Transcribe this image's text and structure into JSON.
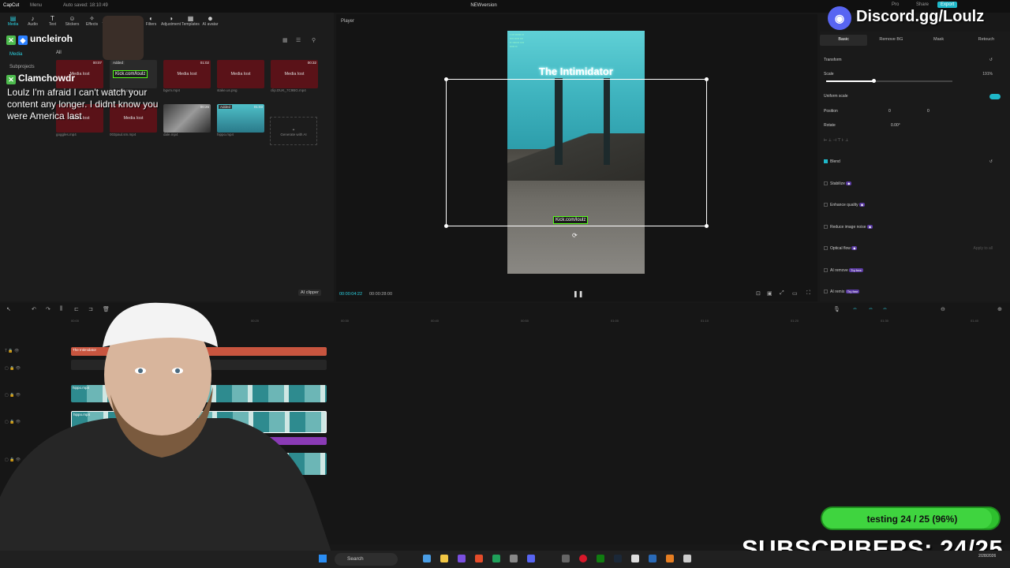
{
  "app": {
    "logo": "CapCut",
    "menu": "Menu",
    "autosave": "Auto saved: 18:10:49",
    "project_title": "NEWversion",
    "pro_label": "Pro",
    "share_label": "Share",
    "export_label": "Export"
  },
  "toolbar": {
    "items": [
      {
        "icon": "media-icon",
        "label": "Media"
      },
      {
        "icon": "audio-icon",
        "label": "Audio"
      },
      {
        "icon": "text-icon",
        "label": "Text"
      },
      {
        "icon": "stickers-icon",
        "label": "Stickers"
      },
      {
        "icon": "effects-icon",
        "label": "Effects"
      },
      {
        "icon": "transitions-icon",
        "label": "Transitions"
      },
      {
        "icon": "captions-icon",
        "label": "Captions"
      },
      {
        "icon": "filters-icon",
        "label": "Filters"
      },
      {
        "icon": "adjustment-icon",
        "label": "Adjustment"
      },
      {
        "icon": "templates-icon",
        "label": "Templates"
      },
      {
        "icon": "ai-avatar-icon",
        "label": "AI avatar"
      }
    ]
  },
  "media_panel": {
    "nav_media": "Media",
    "nav_subprojects": "Subprojects",
    "filter_all": "All",
    "thumbs_row1": [
      {
        "lost": "Media lost",
        "dur": "00:07",
        "name": ""
      },
      {
        "lost": "",
        "dur": "",
        "added": "Added",
        "name": "kick.Loulz.png",
        "tag": "Kick.com/loulz"
      },
      {
        "lost": "Media lost",
        "dur": "01:02",
        "name": "bgvm.mp4"
      },
      {
        "lost": "Media lost",
        "dur": "",
        "name": "stake.us.png"
      },
      {
        "lost": "Media lost",
        "dur": "00:32",
        "name": "clip.DUK_7C9BG.mp4"
      }
    ],
    "thumbs_row2": [
      {
        "lost": "Media lost",
        "name": "goggles.mp4"
      },
      {
        "lost": "Media lost",
        "name": "003paul.sm.mp4"
      },
      {
        "lost": "",
        "dur": "00:26",
        "name": "dale.mp4"
      },
      {
        "lost": "",
        "dur": "01:03",
        "added": "Added",
        "name": "hippo.mp4"
      }
    ],
    "generate_ai": "Generate with AI",
    "ai_clipper": "AI clipper"
  },
  "chat": {
    "user1": "uncleiroh",
    "user2": "Clamchowdr",
    "message": "Loulz I'm afraid I can't watch your content any longer. I didnt know you were America last"
  },
  "player": {
    "label": "Player",
    "video_title": "The Intimidator",
    "kick_tag": "Kick.com/loulz",
    "time_current": "00:00:04:22",
    "time_total": "00:00:28:00"
  },
  "right_panel": {
    "tabs": [
      "Basic",
      "Remove BG",
      "Mask",
      "Retouch"
    ],
    "transform": "Transform",
    "scale_label": "Scale",
    "scale_value": "191%",
    "uniform_scale": "Uniform scale",
    "position_label": "Position",
    "pos_x": "0",
    "pos_y": "0",
    "rotate_label": "Rotate",
    "rotate_value": "0.00°",
    "blend": "Blend",
    "stabilize": "Stabilize",
    "enhance_quality": "Enhance quality",
    "reduce_noise": "Reduce image noise",
    "optical_flow": "Optical flow",
    "ai_remove": "AI remove",
    "ai_remix": "AI remix",
    "try_free": "Try free",
    "apply_all": "Apply to all"
  },
  "timeline": {
    "ruler": [
      "00:00",
      "00:10",
      "00:20",
      "00:30",
      "00:40",
      "00:50",
      "01:00",
      "01:10",
      "01:20",
      "01:30",
      "01:40"
    ],
    "text_clip": "The Intimidator",
    "clip1": "hippo.mp4",
    "clip2": "hippo.mp4"
  },
  "overlay": {
    "discord": "Discord.gg/Loulz",
    "progress_text": "testing 24 / 25 (96%)",
    "progress": 0.96,
    "subscribers": "SUBSCRIBERS: 24/25"
  },
  "taskbar": {
    "search": "Search",
    "clock": "2/28/2026"
  },
  "colors": {
    "accent": "#2bd0e0",
    "media_lost": "#5a1218",
    "progress_green": "#3fd43f",
    "discord": "#5865f2"
  }
}
